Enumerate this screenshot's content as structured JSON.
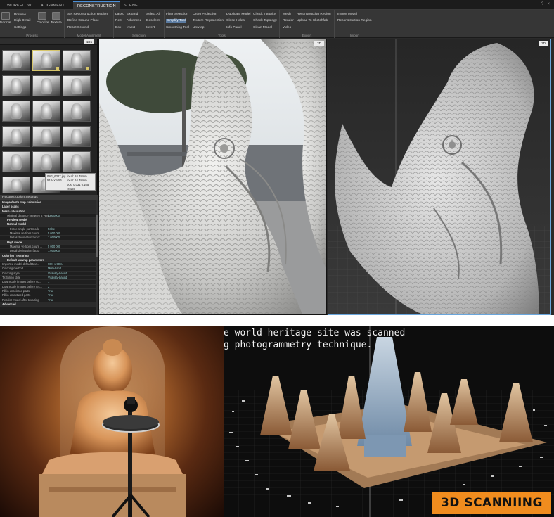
{
  "app": {
    "tabs": [
      "WORKFLOW",
      "ALIGNMENT",
      "RECONSTRUCTION",
      "SCENE"
    ],
    "active_tab": "RECONSTRUCTION",
    "window_controls": "? - ×"
  },
  "ribbon": {
    "process": {
      "label": "Process",
      "big_items": [
        "Normal Detail",
        "Colorize",
        "Texture"
      ],
      "items": [
        "Preview",
        "High Detail",
        "Settings"
      ]
    },
    "model_alignment": {
      "label": "Model Alignment",
      "items": [
        "Set Reconstruction Region",
        "Define Ground Plane",
        "Reset Ground"
      ]
    },
    "selection": {
      "label": "Selection",
      "col1": [
        "Lasso",
        "Rect",
        "Box"
      ],
      "col2": [
        "Expand",
        "Advanced",
        "Invert"
      ],
      "col3": [
        "Select All",
        "Deselect",
        "Invert"
      ]
    },
    "tools": {
      "label": "Tools",
      "col1": [
        "Filter Selection",
        "Simplify Tool",
        "Smoothing Tool"
      ],
      "col2": [
        "Ortho Projection",
        "Texture Reprojection",
        "Unwrap"
      ],
      "col3": [
        "Duplicate Model",
        "Close Holes",
        "Info Panel"
      ],
      "col4": [
        "Check Integrity",
        "Check Topology",
        "Clean Model"
      ]
    },
    "export": {
      "label": "Export",
      "col1": [
        "Mesh",
        "Render",
        "Video"
      ],
      "col2": [
        "Reconstruction Region",
        "Upload To Sketchfab"
      ]
    },
    "import": {
      "label": "Import",
      "items": [
        "Import Model",
        "Reconstruction Region"
      ]
    }
  },
  "left_panel": {
    "badge": "1Ds",
    "tooltip": {
      "lines": [
        "IMG_6387.jpg",
        "5184x3456",
        "focal: 84.48mm",
        "focal: 64.48mm",
        "pos: 0.031 0.165 -0.123"
      ]
    }
  },
  "settings": {
    "title": "Reconstruction Settings",
    "rows": [
      {
        "k": "Image depth map calculation",
        "v": "",
        "t": "sec"
      },
      {
        "k": "Laser scans",
        "v": "",
        "t": "sec"
      },
      {
        "k": "Mesh calculation",
        "v": "",
        "t": "sec"
      },
      {
        "k": "Minimal distance between 2 vertices",
        "v": "0.000000",
        "t": "sub"
      },
      {
        "k": "Preview model",
        "v": "",
        "t": "sec sub"
      },
      {
        "k": "Normal model",
        "v": "",
        "t": "sec sub"
      },
      {
        "k": "Force single-part mode",
        "v": "False",
        "t": "sub2"
      },
      {
        "k": "Maximal vertices count ...",
        "v": "5 000 000",
        "t": "sub2"
      },
      {
        "k": "Detail decimation factor",
        "v": "1.000000",
        "t": "sub2"
      },
      {
        "k": "High model",
        "v": "",
        "t": "sec sub"
      },
      {
        "k": "Maximal vertices count ...",
        "v": "5 000 000",
        "t": "sub2"
      },
      {
        "k": "Detail decimation factor",
        "v": "1.000000",
        "t": "sub2"
      },
      {
        "k": "Coloring / texturing",
        "v": "",
        "t": "sec"
      },
      {
        "k": "Default unwrap parameters",
        "v": "",
        "t": "sec sub"
      },
      {
        "k": "Imported model default text...",
        "v": "90% x 90%",
        "t": ""
      },
      {
        "k": "Coloring method",
        "v": "Multi-band",
        "t": ""
      },
      {
        "k": "Coloring style",
        "v": "Visibility-based",
        "t": ""
      },
      {
        "k": "Texturing style",
        "v": "Visibility-based",
        "t": ""
      },
      {
        "k": "Downscale images before co...",
        "v": "1",
        "t": ""
      },
      {
        "k": "Downscale images before tex...",
        "v": "2",
        "t": ""
      },
      {
        "k": "Fill in uncolored parts",
        "v": "True",
        "t": ""
      },
      {
        "k": "Fill in untextured parts",
        "v": "True",
        "t": ""
      },
      {
        "k": "Recolor model after texturing",
        "v": "True",
        "t": ""
      },
      {
        "k": "Advanced",
        "v": "",
        "t": "sec"
      }
    ]
  },
  "viewports": {
    "view1_badge": "2D",
    "view2_badge": "3D"
  },
  "render": {
    "line1": "e world heritage site was scanned",
    "line2": "g photogrammetry technique.",
    "brand": "3D SCANNIING"
  },
  "colors": {
    "accent": "#4a8fd8",
    "brand_orange": "#f08c1e",
    "viewport_border": "#6aa6dc"
  }
}
